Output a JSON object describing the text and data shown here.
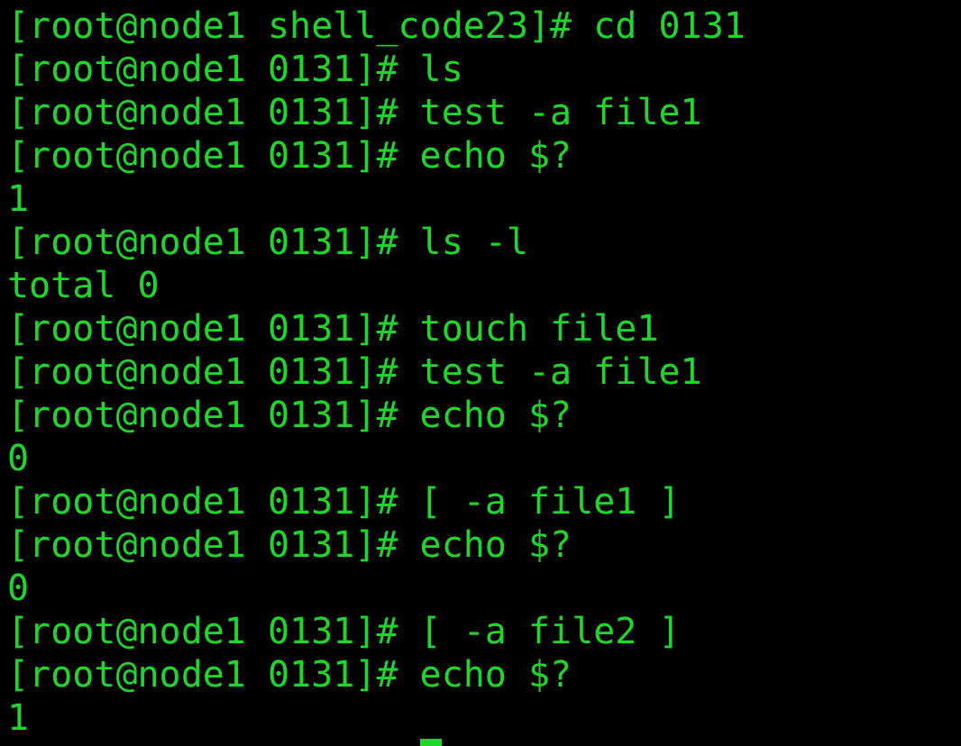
{
  "terminal": {
    "lines": [
      "[root@node1 shell_code23]# cd 0131",
      "[root@node1 0131]# ls",
      "[root@node1 0131]# test -a file1",
      "[root@node1 0131]# echo $?",
      "1",
      "[root@node1 0131]# ls -l",
      "total 0",
      "[root@node1 0131]# touch file1",
      "[root@node1 0131]# test -a file1",
      "[root@node1 0131]# echo $?",
      "0",
      "[root@node1 0131]# [ -a file1 ]",
      "[root@node1 0131]# echo $?",
      "0",
      "[root@node1 0131]# [ -a file2 ]",
      "[root@node1 0131]# echo $?",
      "1"
    ]
  }
}
